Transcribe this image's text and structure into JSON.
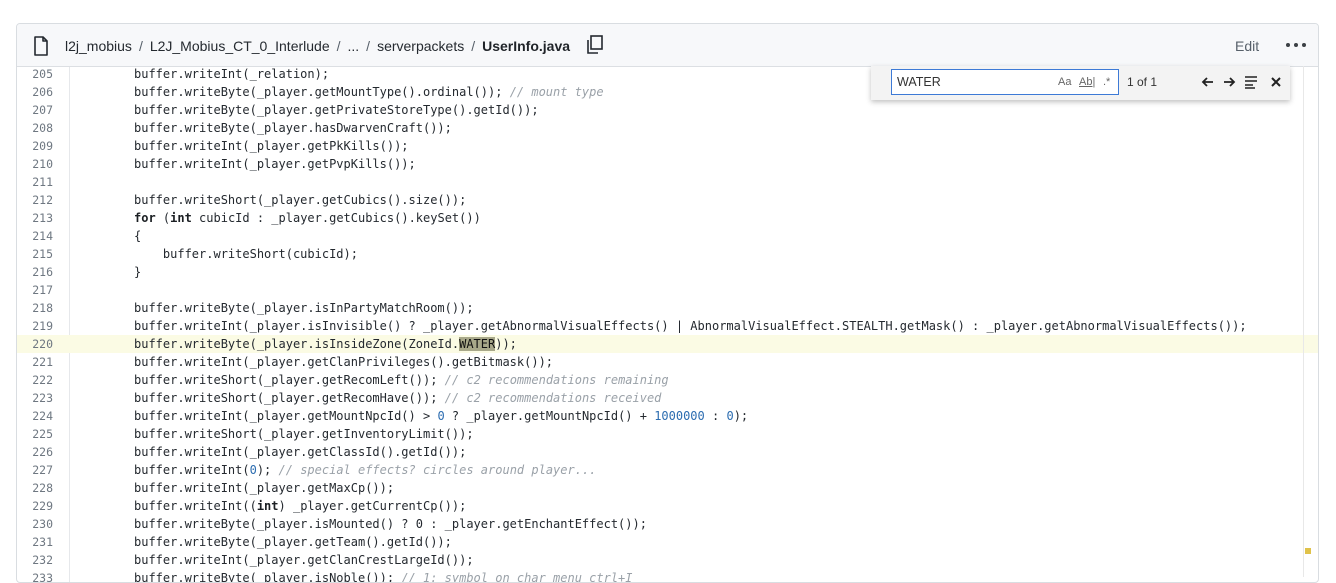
{
  "header": {
    "crumbs": [
      "l2j_mobius",
      "L2J_Mobius_CT_0_Interlude",
      "...",
      "serverpackets"
    ],
    "current_file": "UserInfo.java",
    "separator": "/",
    "edit_label": "Edit",
    "icons": [
      "file-icon",
      "copy-icon",
      "more-icon"
    ]
  },
  "find_widget": {
    "query": "WATER",
    "match_case_label": "Aa",
    "whole_word_label": "Ab|",
    "regex_label": ".*",
    "count": "1 of 1",
    "icons": [
      "arrow-left-icon",
      "arrow-right-icon",
      "find-in-selection-icon",
      "close-icon"
    ]
  },
  "highlight_line": "220",
  "lines": [
    {
      "n": "205",
      "parts": [
        [
          "",
          "buffer.writeInt(_relation);"
        ]
      ]
    },
    {
      "n": "206",
      "parts": [
        [
          "",
          "buffer.writeByte(_player.getMountType().ordinal()); "
        ],
        [
          "cmt",
          "// mount type"
        ]
      ]
    },
    {
      "n": "207",
      "parts": [
        [
          "",
          "buffer.writeByte(_player.getPrivateStoreType().getId());"
        ]
      ]
    },
    {
      "n": "208",
      "parts": [
        [
          "",
          "buffer.writeByte(_player.hasDwarvenCraft());"
        ]
      ]
    },
    {
      "n": "209",
      "parts": [
        [
          "",
          "buffer.writeInt(_player.getPkKills());"
        ]
      ]
    },
    {
      "n": "210",
      "parts": [
        [
          "",
          "buffer.writeInt(_player.getPvpKills());"
        ]
      ]
    },
    {
      "n": "211",
      "parts": []
    },
    {
      "n": "212",
      "parts": [
        [
          "",
          "buffer.writeShort(_player.getCubics().size());"
        ]
      ]
    },
    {
      "n": "213",
      "parts": [
        [
          "kw",
          "for"
        ],
        [
          "",
          " ("
        ],
        [
          "kw",
          "int"
        ],
        [
          "",
          " cubicId : _player.getCubics().keySet())"
        ]
      ]
    },
    {
      "n": "214",
      "parts": [
        [
          "",
          "{"
        ]
      ]
    },
    {
      "n": "215",
      "parts": [
        [
          "",
          "    buffer.writeShort(cubicId);"
        ]
      ]
    },
    {
      "n": "216",
      "parts": [
        [
          "",
          "}"
        ]
      ]
    },
    {
      "n": "217",
      "parts": []
    },
    {
      "n": "218",
      "parts": [
        [
          "",
          "buffer.writeByte(_player.isInPartyMatchRoom());"
        ]
      ]
    },
    {
      "n": "219",
      "parts": [
        [
          "",
          "buffer.writeInt(_player.isInvisible() ? _player.getAbnormalVisualEffects() | AbnormalVisualEffect.STEALTH.getMask() : _player.getAbnormalVisualEffects());"
        ]
      ]
    },
    {
      "n": "220",
      "parts": [
        [
          "",
          "buffer.writeByte(_player.isInsideZone(ZoneId."
        ],
        [
          "match",
          "WATER"
        ],
        [
          "",
          "));"
        ]
      ]
    },
    {
      "n": "221",
      "parts": [
        [
          "",
          "buffer.writeInt(_player.getClanPrivileges().getBitmask());"
        ]
      ]
    },
    {
      "n": "222",
      "parts": [
        [
          "",
          "buffer.writeShort(_player.getRecomLeft()); "
        ],
        [
          "cmt",
          "// c2 recommendations remaining"
        ]
      ]
    },
    {
      "n": "223",
      "parts": [
        [
          "",
          "buffer.writeShort(_player.getRecomHave()); "
        ],
        [
          "cmt",
          "// c2 recommendations received"
        ]
      ]
    },
    {
      "n": "224",
      "parts": [
        [
          "",
          "buffer.writeInt(_player.getMountNpcId() > "
        ],
        [
          "num",
          "0"
        ],
        [
          "",
          " ? _player.getMountNpcId() + "
        ],
        [
          "num",
          "1000000"
        ],
        [
          "",
          " : "
        ],
        [
          "num",
          "0"
        ],
        [
          "",
          ");"
        ]
      ]
    },
    {
      "n": "225",
      "parts": [
        [
          "",
          "buffer.writeShort(_player.getInventoryLimit());"
        ]
      ]
    },
    {
      "n": "226",
      "parts": [
        [
          "",
          "buffer.writeInt(_player.getClassId().getId());"
        ]
      ]
    },
    {
      "n": "227",
      "parts": [
        [
          "",
          "buffer.writeInt("
        ],
        [
          "num",
          "0"
        ],
        [
          "",
          "); "
        ],
        [
          "cmt",
          "// special effects? circles around player..."
        ]
      ]
    },
    {
      "n": "228",
      "parts": [
        [
          "",
          "buffer.writeInt(_player.getMaxCp());"
        ]
      ]
    },
    {
      "n": "229",
      "parts": [
        [
          "",
          "buffer.writeInt(("
        ],
        [
          "kw",
          "int"
        ],
        [
          "",
          ") _player.getCurrentCp());"
        ]
      ]
    },
    {
      "n": "230",
      "parts": [
        [
          "",
          "buffer.writeByte(_player.isMounted() ? 0 : _player.getEnchantEffect());"
        ]
      ]
    },
    {
      "n": "231",
      "parts": [
        [
          "",
          "buffer.writeByte(_player.getTeam().getId());"
        ]
      ]
    },
    {
      "n": "232",
      "parts": [
        [
          "",
          "buffer.writeInt(_player.getClanCrestLargeId());"
        ]
      ]
    },
    {
      "n": "233",
      "parts": [
        [
          "",
          "buffer.writeByte(_player.isNoble()); "
        ],
        [
          "cmt",
          "// 1: symbol on char menu ctrl+I"
        ]
      ]
    }
  ]
}
